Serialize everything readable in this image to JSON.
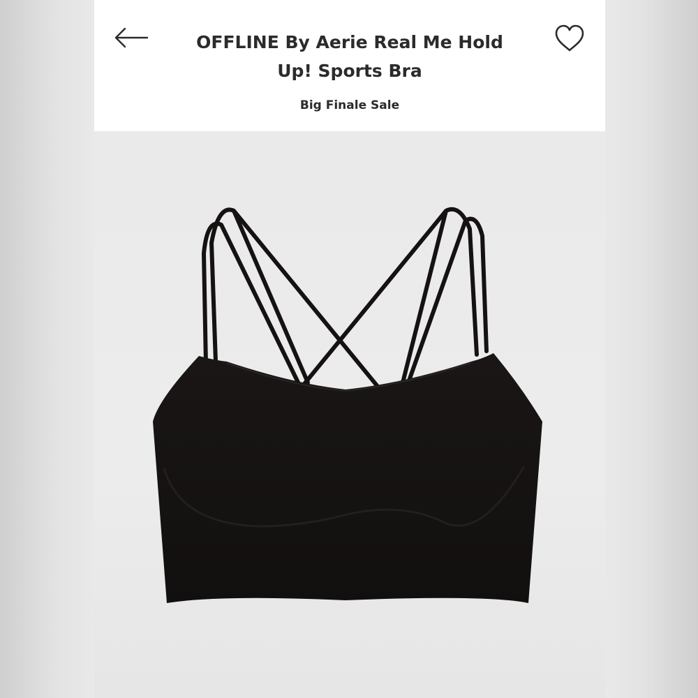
{
  "header": {
    "back_icon": "arrow-left-icon",
    "title": "OFFLINE By Aerie Real Me Hold Up! Sports Bra",
    "subtitle": "Big Finale Sale",
    "favorite_icon": "heart-outline-icon"
  },
  "product": {
    "image_subject": "black strappy sports bra",
    "colors": {
      "garment": "#141111",
      "background": "#ebebeb"
    }
  }
}
